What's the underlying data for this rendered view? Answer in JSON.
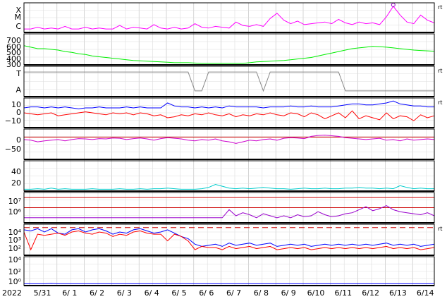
{
  "chart_data": {
    "type": "line",
    "year_label": "2022",
    "x_ticks": [
      "5/31",
      "6/ 1",
      "6/ 2",
      "6/ 3",
      "6/ 4",
      "6/ 5",
      "6/ 6",
      "6/ 7",
      "6/ 8",
      "6/ 9",
      "6/10",
      "6/11",
      "6/12",
      "6/13",
      "6/14"
    ],
    "grid": true,
    "panels": [
      {
        "id": "xray",
        "ytick_labels": [
          "X",
          "M",
          "C"
        ],
        "right_label": "rt",
        "series": [
          {
            "color": "#ff00ff",
            "values": [
              1,
              1,
              1.2,
              1,
              1.1,
              1,
              1.3,
              1,
              1,
              1.2,
              1,
              1.1,
              1,
              1,
              1.4,
              1,
              1.2,
              1.1,
              1,
              1.5,
              1.1,
              1,
              1.2,
              1,
              1.1,
              1.6,
              1.2,
              1.1,
              1.3,
              1.2,
              1.1,
              1.8,
              1.4,
              1.3,
              1.5,
              1.3,
              2.2,
              2.8,
              2.0,
              1.6,
              1.9,
              1.5,
              1.6,
              1.7,
              1.8,
              1.6,
              2.1,
              1.7,
              1.5,
              1.8,
              1.6,
              1.7,
              1.5,
              2.4,
              3.6,
              2.6,
              1.8,
              1.6,
              2.6,
              2.0,
              1.7
            ]
          }
        ],
        "marker": {
          "x_index": 54,
          "color": "#9900cc"
        }
      },
      {
        "id": "sw_speed",
        "ytick_labels": [
          "700",
          "600",
          "500",
          "400",
          "300"
        ],
        "series": [
          {
            "color": "#00ee00",
            "values": [
              560,
              540,
              520,
              520,
              510,
              500,
              480,
              470,
              450,
              440,
              420,
              410,
              400,
              390,
              380,
              370,
              360,
              355,
              350,
              345,
              340,
              335,
              330,
              330,
              330,
              325,
              320,
              320,
              320,
              320,
              320,
              320,
              320,
              330,
              340,
              345,
              350,
              355,
              360,
              370,
              380,
              390,
              400,
              420,
              440,
              460,
              480,
              500,
              520,
              530,
              540,
              550,
              545,
              540,
              530,
              520,
              510,
              500,
              495,
              490,
              485
            ]
          }
        ]
      },
      {
        "id": "imf_sector",
        "ytick_labels": [
          "T",
          "A"
        ],
        "right_label": "rt",
        "series": [
          {
            "color": "#888888",
            "values": [
              1,
              1,
              1,
              1,
              1,
              1,
              1,
              1,
              1,
              1,
              1,
              1,
              1,
              1,
              1,
              1,
              1,
              1,
              1,
              1,
              1,
              1,
              1,
              1,
              1,
              0,
              0,
              1,
              1,
              1,
              1,
              1,
              1,
              1,
              1,
              0,
              1,
              1,
              1,
              1,
              1,
              1,
              1,
              1,
              1,
              1,
              1,
              0,
              0,
              0,
              0,
              0,
              0,
              0,
              0,
              0,
              0,
              0,
              0,
              0,
              0
            ]
          }
        ]
      },
      {
        "id": "imf_bt",
        "ytick_labels": [
          "10",
          "0",
          "−10"
        ],
        "right_label": "rt",
        "series": [
          {
            "color": "#0000ff",
            "values": [
              5,
              6,
              6,
              5,
              6,
              5,
              6,
              5,
              4,
              5,
              5,
              6,
              5,
              5,
              5,
              6,
              5,
              6,
              5,
              5,
              5,
              10,
              7,
              6,
              6,
              5,
              6,
              5,
              6,
              5,
              7,
              6,
              6,
              6,
              6,
              5,
              6,
              6,
              6,
              7,
              6,
              6,
              7,
              6,
              6,
              6,
              7,
              8,
              9,
              9,
              8,
              8,
              9,
              10,
              12,
              9,
              8,
              7,
              7,
              6,
              6
            ]
          },
          {
            "color": "#ff0000",
            "values": [
              0,
              -1,
              -2,
              -1,
              0,
              -3,
              -2,
              -1,
              0,
              1,
              0,
              -1,
              -2,
              0,
              -1,
              0,
              -2,
              0,
              -1,
              -3,
              -2,
              -5,
              -4,
              -2,
              -3,
              -1,
              -2,
              0,
              -2,
              -3,
              -1,
              -4,
              -2,
              -3,
              -1,
              -2,
              0,
              -2,
              -3,
              0,
              -1,
              -4,
              0,
              -2,
              -6,
              -3,
              0,
              -5,
              2,
              -6,
              -3,
              -5,
              -7,
              0,
              -6,
              -3,
              -4,
              -8,
              -2,
              -5,
              -3
            ]
          }
        ]
      },
      {
        "id": "dst",
        "ytick_labels": [
          "0",
          "−50"
        ],
        "series": [
          {
            "color": "#cc00cc",
            "values": [
              -8,
              -10,
              -15,
              -12,
              -10,
              -8,
              -12,
              -8,
              -5,
              -6,
              -8,
              -5,
              -6,
              -3,
              -4,
              -8,
              -5,
              -3,
              -6,
              -10,
              -5,
              -2,
              -4,
              -6,
              -10,
              -12,
              -8,
              -10,
              -6,
              -12,
              -15,
              -20,
              -15,
              -10,
              -12,
              -8,
              -6,
              -10,
              -4,
              -2,
              -3,
              -5,
              2,
              5,
              6,
              4,
              2,
              -2,
              -4,
              -6,
              -8,
              -6,
              -4,
              -10,
              -8,
              -12,
              -6,
              -10,
              -8,
              -6,
              -8
            ]
          }
        ],
        "ref_line": {
          "y": 0,
          "color": "#cc0000"
        }
      },
      {
        "id": "ae",
        "ytick_labels": [
          "40",
          "20"
        ],
        "series": [
          {
            "color": "#00cccc",
            "values": [
              3,
              3,
              4,
              3,
              5,
              3,
              4,
              3,
              3,
              3,
              4,
              3,
              3,
              3,
              4,
              3,
              3,
              4,
              3,
              4,
              4,
              5,
              4,
              3,
              3,
              3,
              4,
              6,
              11,
              8,
              5,
              4,
              5,
              4,
              5,
              6,
              5,
              4,
              4,
              3,
              4,
              5,
              4,
              4,
              5,
              4,
              4,
              5,
              5,
              6,
              5,
              5,
              4,
              5,
              4,
              9,
              6,
              4,
              5,
              4,
              4
            ]
          }
        ]
      },
      {
        "id": "electron_flux",
        "ytick_labels": [
          "10⁷",
          "10⁶"
        ],
        "series": [
          {
            "color": "#9900cc",
            "values": [
              5,
              5,
              5,
              5,
              5,
              5,
              5,
              5,
              5,
              5,
              5,
              5,
              5,
              5,
              5,
              5,
              5,
              5,
              5,
              5,
              5,
              5,
              5,
              5,
              5,
              5,
              5,
              5,
              5,
              5,
              5.8,
              5.2,
              5.5,
              5.3,
              5,
              5.4,
              5.2,
              5,
              5.2,
              5,
              5.3,
              5.1,
              5.2,
              5.6,
              5.3,
              5.1,
              5.2,
              5.4,
              5.5,
              5.8,
              6.1,
              5.7,
              5.9,
              6.2,
              5.8,
              5.6,
              5.5,
              5.4,
              5.3,
              5.5,
              5.2
            ]
          }
        ],
        "ref_lines": [
          {
            "y": 7,
            "color": "#cc0000"
          },
          {
            "y": 6,
            "color": "#cc0000"
          }
        ]
      },
      {
        "id": "proton_flux",
        "ytick_labels": [
          "10⁴",
          "10³",
          "10²"
        ],
        "right_label": "rt",
        "series": [
          {
            "color": "#0000ff",
            "values": [
              3.8,
              3.7,
              3.9,
              3.6,
              3.9,
              3.5,
              3.4,
              3.8,
              3.9,
              3.6,
              3.8,
              3.9,
              3.7,
              3.4,
              3.6,
              3.5,
              3.8,
              3.9,
              3.7,
              3.5,
              3.6,
              3.8,
              3.5,
              3.2,
              3.0,
              2.5,
              2.3,
              2.4,
              2.5,
              2.3,
              2.6,
              2.4,
              2.5,
              2.6,
              2.4,
              2.5,
              2.6,
              2.3,
              2.4,
              2.5,
              2.4,
              2.5,
              2.3,
              2.4,
              2.5,
              2.4,
              2.5,
              2.4,
              2.5,
              2.4,
              2.5,
              2.4,
              2.5,
              2.6,
              2.4,
              2.5,
              2.4,
              2.5,
              2.3,
              2.4,
              2.5
            ]
          },
          {
            "color": "#ff0000",
            "values": [
              3.6,
              2.0,
              3.4,
              3.3,
              3.4,
              3.5,
              3.3,
              3.6,
              3.7,
              3.5,
              3.4,
              3.6,
              3.5,
              3.2,
              3.4,
              3.3,
              3.6,
              3.7,
              3.5,
              3.4,
              3.4,
              2.8,
              3.4,
              3.2,
              2.8,
              2.0,
              2.3,
              2.2,
              2.2,
              2.0,
              2.3,
              2.1,
              2.2,
              2.3,
              2.1,
              2.2,
              2.3,
              2.0,
              2.1,
              2.2,
              2.1,
              2.2,
              2.0,
              2.1,
              2.2,
              2.1,
              2.2,
              2.1,
              2.2,
              2.1,
              2.2,
              2.1,
              2.2,
              2.3,
              2.1,
              2.2,
              2.1,
              2.2,
              2.0,
              2.1,
              2.2
            ]
          }
        ],
        "ref_line": {
          "y": 4,
          "color": "#cc0000",
          "dashed": true
        }
      },
      {
        "id": "neutron",
        "ytick_labels": [
          "10⁴",
          "10²",
          "10⁰"
        ],
        "series": [
          {
            "color": "#0000ff",
            "values": [
              0.1,
              0.1,
              0.1,
              0.1,
              0.15,
              0.1,
              0.1,
              0.1,
              0.1,
              0.1,
              0.1,
              0.1,
              0.1,
              0.1,
              0.1,
              0.1,
              0.1,
              0.1,
              0.1,
              0.1,
              0.1,
              0.1,
              0.1,
              0.1,
              0.1,
              0.1,
              0.1,
              0.1,
              0.1,
              0.1,
              0.1,
              0.1,
              0.1,
              0.1,
              0.1,
              0.1,
              0.1,
              0.1,
              0.1,
              0.1,
              0.1,
              0.1,
              0.1,
              0.1,
              0.1,
              0.1,
              0.1,
              0.1,
              0.1,
              0.1,
              0.1,
              0.1,
              0.1,
              0.1,
              0.1,
              0.1,
              0.1,
              0.1,
              0.1,
              0.1,
              0.1
            ]
          }
        ]
      }
    ]
  }
}
